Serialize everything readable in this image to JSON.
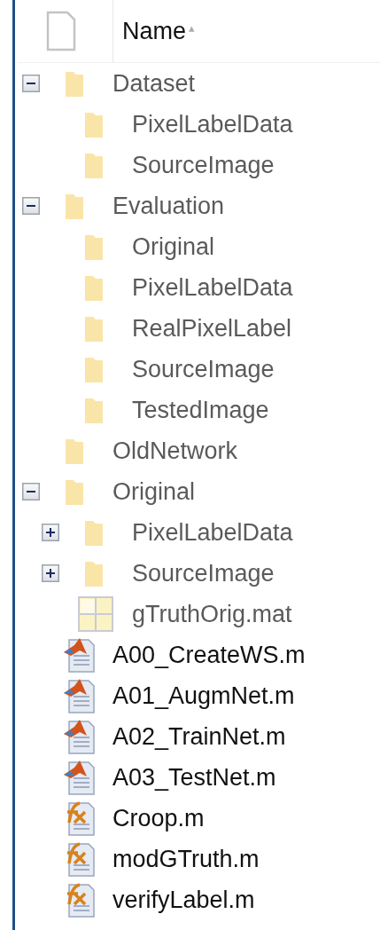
{
  "header": {
    "column": "Name",
    "sort_mark": "▴"
  },
  "tree": [
    {
      "name": "Dataset",
      "kind": "folder",
      "dimmed": true,
      "expanded": true,
      "children": [
        {
          "name": "PixelLabelData",
          "kind": "folder",
          "dimmed": true
        },
        {
          "name": "SourceImage",
          "kind": "folder",
          "dimmed": true
        }
      ]
    },
    {
      "name": "Evaluation",
      "kind": "folder",
      "dimmed": true,
      "expanded": true,
      "children": [
        {
          "name": "Original",
          "kind": "folder",
          "dimmed": true
        },
        {
          "name": "PixelLabelData",
          "kind": "folder",
          "dimmed": true
        },
        {
          "name": "RealPixelLabel",
          "kind": "folder",
          "dimmed": true
        },
        {
          "name": "SourceImage",
          "kind": "folder",
          "dimmed": true
        },
        {
          "name": "TestedImage",
          "kind": "folder",
          "dimmed": true
        }
      ]
    },
    {
      "name": "OldNetwork",
      "kind": "folder",
      "dimmed": true
    },
    {
      "name": "Original",
      "kind": "folder",
      "dimmed": true,
      "expanded": true,
      "children": [
        {
          "name": "PixelLabelData",
          "kind": "folder",
          "dimmed": true,
          "expanded": false
        },
        {
          "name": "SourceImage",
          "kind": "folder",
          "dimmed": true,
          "expanded": false
        },
        {
          "name": "gTruthOrig.mat",
          "kind": "mat",
          "dimmed": true
        }
      ]
    },
    {
      "name": "A00_CreateWS.m",
      "kind": "script",
      "dimmed": false
    },
    {
      "name": "A01_AugmNet.m",
      "kind": "script",
      "dimmed": false
    },
    {
      "name": "A02_TrainNet.m",
      "kind": "script",
      "dimmed": false
    },
    {
      "name": "A03_TestNet.m",
      "kind": "script",
      "dimmed": false
    },
    {
      "name": "Croop.m",
      "kind": "function",
      "dimmed": false
    },
    {
      "name": "modGTruth.m",
      "kind": "function",
      "dimmed": false
    },
    {
      "name": "verifyLabel.m",
      "kind": "function",
      "dimmed": false
    }
  ]
}
